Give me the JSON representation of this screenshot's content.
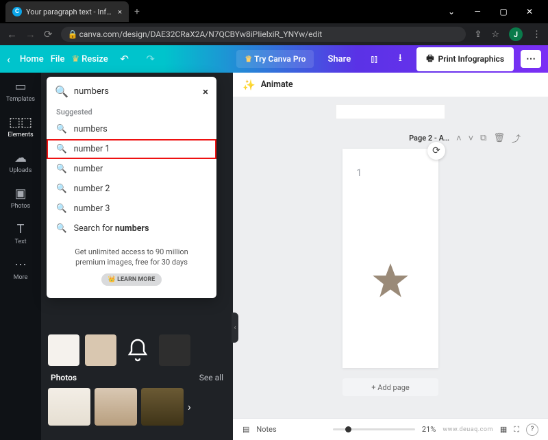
{
  "browser": {
    "tab_title": "Your paragraph text - Infographi",
    "url": "canva.com/design/DAE32CRaX2A/N7QCBYw8iPIielxiR_YNYw/edit",
    "avatar_letter": "J"
  },
  "topbar": {
    "home": "Home",
    "file": "File",
    "resize": "Resize",
    "try_pro": "Try Canva Pro",
    "share": "Share",
    "print": "Print Infographics"
  },
  "siderail": {
    "templates": "Templates",
    "elements": "Elements",
    "uploads": "Uploads",
    "photos": "Photos",
    "text": "Text",
    "more": "More"
  },
  "search": {
    "value": "numbers",
    "suggested_label": "Suggested",
    "items": [
      "numbers",
      "number 1",
      "number",
      "number 2",
      "number 3"
    ],
    "searchfor_prefix": "Search for ",
    "searchfor_term": "numbers",
    "promo_l1": "Get unlimited access to 90 million",
    "promo_l2": "premium images, free for 30 days",
    "learn": "LEARN MORE"
  },
  "panel": {
    "photos_label": "Photos",
    "see_all": "See all"
  },
  "canvas": {
    "animate": "Animate",
    "page_label": "Page 2 - A…",
    "page_number": "1",
    "add_page": "+ Add page"
  },
  "bottom": {
    "notes": "Notes",
    "zoom": "21%",
    "watermark": "www.deuaq.com"
  }
}
